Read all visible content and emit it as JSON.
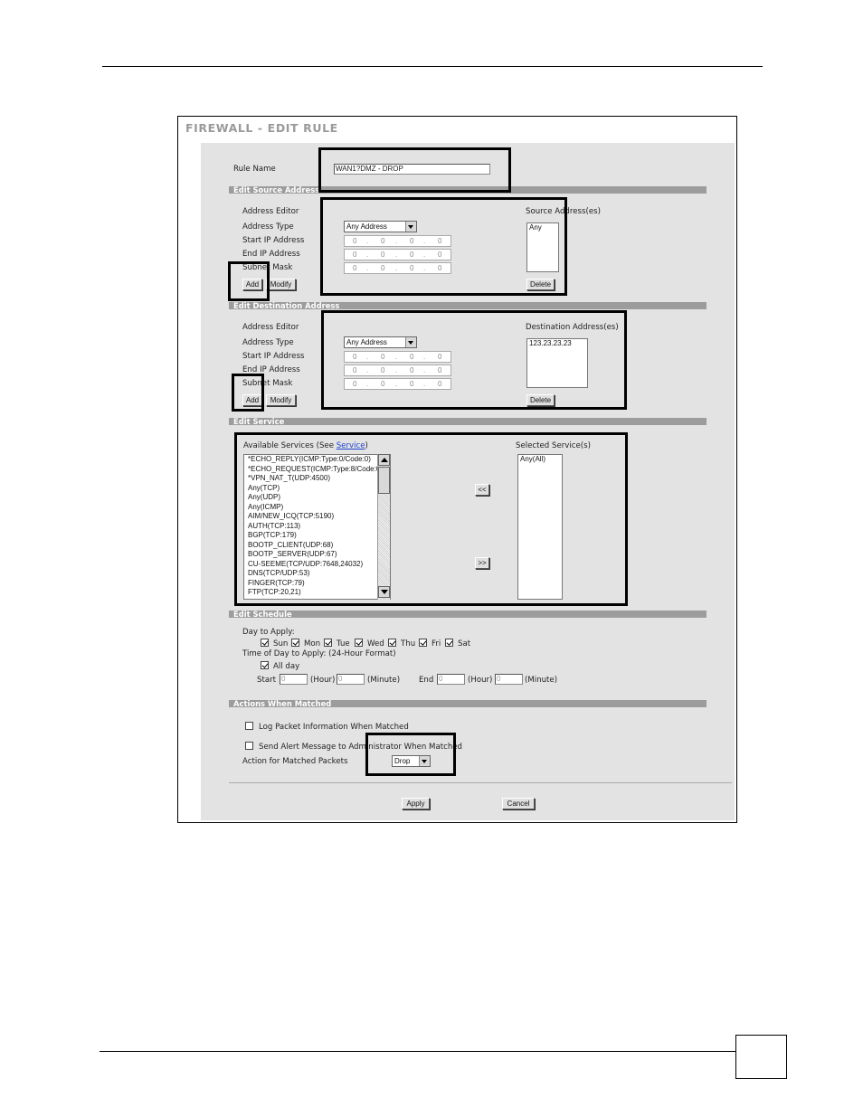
{
  "window": {
    "title": "FIREWALL - EDIT RULE"
  },
  "rule": {
    "name_label": "Rule Name",
    "name_value": "WAN1?DMZ - DROP"
  },
  "source": {
    "section": "Edit Source Address",
    "address_editor": "Address Editor",
    "address_type_label": "Address Type",
    "address_type_value": "Any Address",
    "start_ip_label": "Start IP Address",
    "end_ip_label": "End IP Address",
    "subnet_label": "Subnet Mask",
    "list_label": "Source Address(es)",
    "list_items": [
      "Any"
    ],
    "add": "Add",
    "modify": "Modify",
    "delete": "Delete"
  },
  "destination": {
    "section": "Edit Destination Address",
    "address_editor": "Address Editor",
    "address_type_label": "Address Type",
    "address_type_value": "Any Address",
    "start_ip_label": "Start IP Address",
    "end_ip_label": "End IP Address",
    "subnet_label": "Subnet Mask",
    "list_label": "Destination Address(es)",
    "list_items": [
      "123.23.23.23"
    ],
    "add": "Add",
    "modify": "Modify",
    "delete": "Delete"
  },
  "ip_octets": [
    "0",
    "0",
    "0",
    "0"
  ],
  "ip_dot": ".",
  "service": {
    "section": "Edit Service",
    "available_label": "Available Services  (See ",
    "service_link": "Service",
    "available_suffix": ")",
    "selected_label": "Selected Service(s)",
    "available": [
      "*ECHO_REPLY(ICMP:Type:0/Code:0)",
      "*ECHO_REQUEST(ICMP:Type:8/Code:0)",
      "*VPN_NAT_T(UDP:4500)",
      "Any(TCP)",
      "Any(UDP)",
      "Any(ICMP)",
      "AIM/NEW_ICQ(TCP:5190)",
      "AUTH(TCP:113)",
      "BGP(TCP:179)",
      "BOOTP_CLIENT(UDP:68)",
      "BOOTP_SERVER(UDP:67)",
      "CU-SEEME(TCP/UDP:7648,24032)",
      "DNS(TCP/UDP:53)",
      "FINGER(TCP:79)",
      "FTP(TCP:20,21)"
    ],
    "selected": [
      "Any(All)"
    ],
    "remove_btn": "<<",
    "add_btn": ">>"
  },
  "schedule": {
    "section": "Edit Schedule",
    "day_label": "Day to Apply:",
    "days": [
      "Sun",
      "Mon",
      "Tue",
      "Wed",
      "Thu",
      "Fri",
      "Sat"
    ],
    "time_label": "Time of Day to Apply: (24-Hour Format)",
    "all_day": "All day",
    "start_label": "Start",
    "end_label": "End",
    "hour": "(Hour)",
    "minute": "(Minute)",
    "start_hour": "0",
    "start_minute": "0",
    "end_hour": "0",
    "end_minute": "0"
  },
  "actions": {
    "section": "Actions When Matched",
    "log": "Log Packet Information When Matched",
    "alert": "Send Alert Message to Administrator When Matched",
    "action_label": "Action for Matched Packets",
    "action_value": "Drop"
  },
  "buttons": {
    "apply": "Apply",
    "cancel": "Cancel"
  }
}
